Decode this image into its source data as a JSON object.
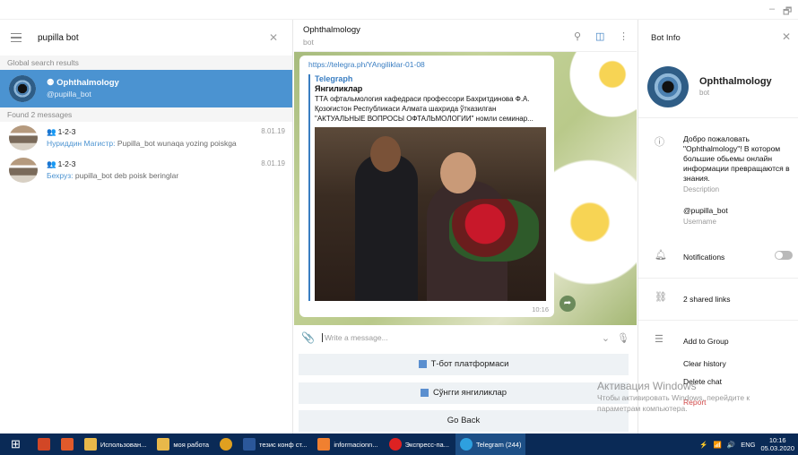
{
  "window": {
    "minimize": "–",
    "restore": "🗗"
  },
  "left": {
    "search_value": "pupilla bot",
    "global_section": "Global search results",
    "global_result": {
      "name": "Ophthalmology",
      "username": "@pupilla_bot"
    },
    "found_section": "Found 2 messages",
    "messages": [
      {
        "group": "1-2-3",
        "sender": "Нуриддин Магистр:",
        "text": "Pupilla_bot wunaqa yozing poiskga",
        "date": "8.01.19"
      },
      {
        "group": "1-2-3",
        "sender": "Бехруз:",
        "text": "pupilla_bot deb poisk beringlar",
        "date": "8.01.19"
      }
    ]
  },
  "chat": {
    "title": "Ophthalmology",
    "status": "bot",
    "link": "https://telegra.ph/YAngiliklar-01-08",
    "preview_site": "Telegraph",
    "preview_title": "Янгиликлар",
    "preview_desc": "ТТА офтальмология кафедраси профессори Бахритдинова Ф.А. Қозоғистон Республикаси Алмата шахрида ўтказилган \"АКТУАЛЬНЫЕ ВОПРОСЫ ОФТАЛЬМОЛОГИИ\" номли семинар...",
    "time": "10:16",
    "compose_placeholder": "Write a message...",
    "buttons": [
      "Т-бот платформаси",
      "Сўнгги янгиликлар",
      "Go Back"
    ]
  },
  "info": {
    "header": "Bot Info",
    "name": "Ophthalmology",
    "status": "bot",
    "description": "Добро пожаловать \"Ophthalmology\"! В котором большие обьемы онлайн информации превращаются в знания.",
    "description_label": "Description",
    "username": "@pupilla_bot",
    "username_label": "Username",
    "notifications": "Notifications",
    "shared_links": "2 shared links",
    "add_to_group": "Add to Group",
    "clear_history": "Clear history",
    "delete_chat": "Delete chat",
    "report": "Report"
  },
  "watermark": {
    "title": "Активация Windows",
    "line1": "Чтобы активировать Windows, перейдите к",
    "line2": "параметрам компьютера."
  },
  "taskbar": {
    "items": [
      "Использован...",
      "моя работа",
      "тезис конф ст...",
      "informacionn...",
      "Экспресс-па...",
      "Telegram (244)"
    ],
    "lang": "ENG",
    "time": "10:16",
    "date": "05.03.2020"
  },
  "colors": {
    "accent": "#4b93d1",
    "taskbar": "#0a2a56",
    "report": "#d14848"
  }
}
